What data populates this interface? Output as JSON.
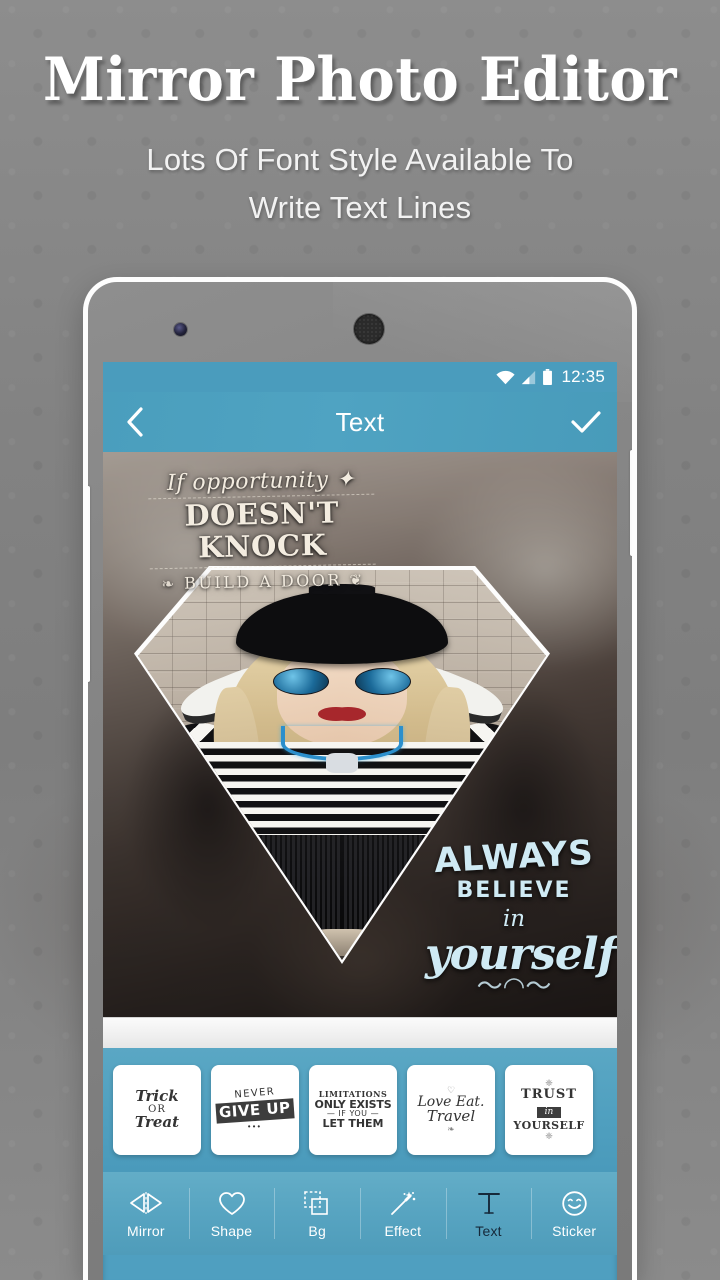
{
  "promo": {
    "title": "Mirror Photo Editor",
    "subtitle_line1": "Lots Of Font Style Available To",
    "subtitle_line2": "Write Text Lines"
  },
  "colors": {
    "accent_teal": "#4a9ebd",
    "nav_teal": "#57a4c1",
    "thumb_strip_teal": "#4f9fbf",
    "active_nav": "#16293a",
    "page_background": "#8a8a8a",
    "frame_white": "#fdfdfd",
    "art_cream": "#f3ece0",
    "art_blue": "#cfeaf4"
  },
  "phone": {
    "camera_icon": "front-camera-icon",
    "speaker_icon": "earpiece-speaker-icon"
  },
  "statusbar": {
    "wifi_icon": "wifi-icon",
    "signal_icon": "cellular-signal-icon",
    "battery_icon": "battery-icon",
    "clock": "12:35"
  },
  "appbar": {
    "back_icon": "back-chevron-icon",
    "title": "Text",
    "done_icon": "check-icon"
  },
  "canvas": {
    "art_top_left": {
      "line1": "If opportunity",
      "line1_star": "✦",
      "line2": "DOESN'T KNOCK",
      "line3": "BUILD A DOOR"
    },
    "art_bottom_right": {
      "line1": "ALWAYS",
      "line2": "BELIEVE",
      "line3": "in",
      "line4": "yourself"
    },
    "shape": "pentagon-diamond-mirror-frame"
  },
  "thumbnails": [
    {
      "id": "trick-or-treat",
      "line1": "Trick",
      "line2": "OR",
      "line3": "Treat"
    },
    {
      "id": "never-give-up",
      "line1": "NEVER",
      "line2": "GIVE UP",
      "line3": "•••"
    },
    {
      "id": "limitations",
      "line1": "LIMITATIONS",
      "line2": "ONLY EXISTS",
      "line3": "— IF YOU —",
      "line4": "LET THEM"
    },
    {
      "id": "love-eat-travel",
      "line1": "Love Eat.",
      "line2": "Travel"
    },
    {
      "id": "trust-in-yourself",
      "line1": "TRUST",
      "line2": "in",
      "line3": "YOURSELF"
    }
  ],
  "bottom_nav": [
    {
      "id": "mirror",
      "label": "Mirror",
      "icon": "mirror-icon",
      "active": false
    },
    {
      "id": "shape",
      "label": "Shape",
      "icon": "heart-icon",
      "active": false
    },
    {
      "id": "bg",
      "label": "Bg",
      "icon": "layers-icon",
      "active": false
    },
    {
      "id": "effect",
      "label": "Effect",
      "icon": "magic-wand-icon",
      "active": false
    },
    {
      "id": "text",
      "label": "Text",
      "icon": "text-t-icon",
      "active": true
    },
    {
      "id": "sticker",
      "label": "Sticker",
      "icon": "smiley-icon",
      "active": false
    }
  ]
}
